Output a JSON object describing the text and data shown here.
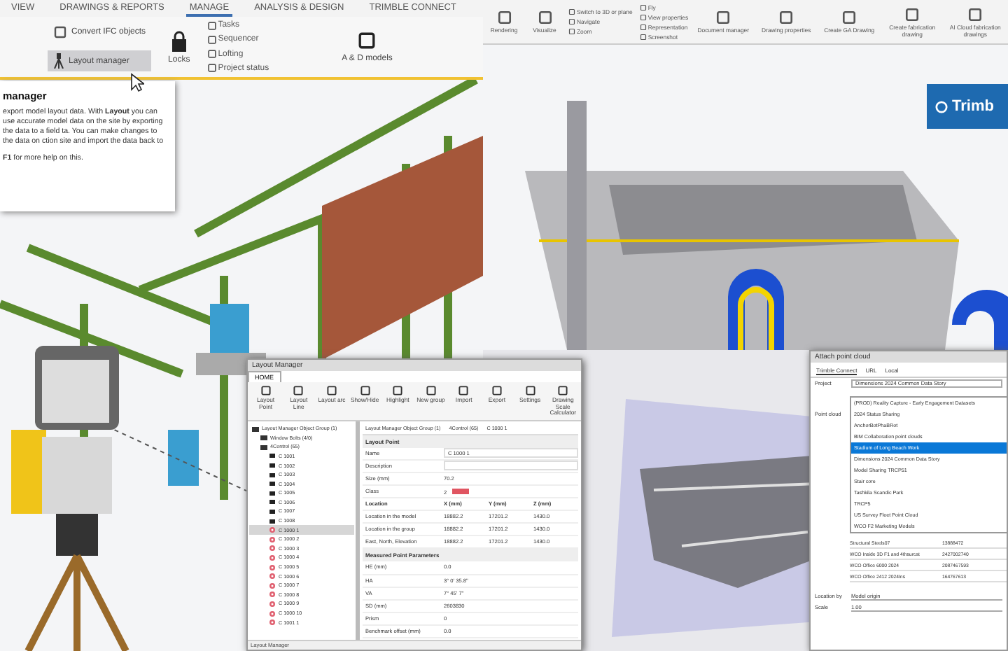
{
  "left_app": {
    "tabs": [
      {
        "label": "VIEW",
        "selected": false
      },
      {
        "label": "DRAWINGS & REPORTS",
        "selected": false
      },
      {
        "label": "MANAGE",
        "selected": true
      },
      {
        "label": "ANALYSIS & DESIGN",
        "selected": false
      },
      {
        "label": "TRIMBLE CONNECT",
        "selected": false
      }
    ],
    "convert_button": "Convert IFC objects",
    "layout_button": {
      "label": "Layout manager",
      "selected": true
    },
    "locks_button": "Locks",
    "small_items": [
      "Tasks",
      "Sequencer",
      "Lofting",
      "Project status"
    ],
    "models_button": "A & D models",
    "tooltip": {
      "title": "manager",
      "body": "export model layout data. With **Layout** you can use accurate model data on the site by exporting the data to a field ta. You can make changes to the data on ction site and import the data back to",
      "footer": "**F1** for more help on this."
    }
  },
  "right_app": {
    "large_tools": [
      "Rendering",
      "Visualize"
    ],
    "small_items": [
      "Switch to 3D or plane",
      "Navigate",
      "Zoom"
    ],
    "small_items_2": [
      "Fly",
      "View properties",
      "Representation",
      "Screenshot"
    ],
    "drawing_tools": [
      "Document manager",
      "Drawing properties",
      "Create GA Drawing",
      "Create fabrication drawing",
      "AI Cloud fabrication drawings"
    ],
    "logo": "Trimb"
  },
  "layout_manager": {
    "title": "Layout Manager",
    "tabs": [
      {
        "label": "HOME",
        "selected": true
      }
    ],
    "tools": [
      "Layout Point",
      "Layout Line",
      "Layout arc",
      "Show/Hide",
      "Highlight",
      "New group",
      "Import",
      "Export",
      "Settings",
      "Drawing Scale Calculator"
    ],
    "tree": [
      {
        "label": "Layout Manager Object Group (1)",
        "kind": "group",
        "selected": false,
        "children": [
          {
            "label": "Window Bolts (4/0)",
            "kind": "group",
            "selected": false
          },
          {
            "label": "4Control (65)",
            "kind": "group",
            "selected": false,
            "children": [
              {
                "label": "C 1001",
                "kind": "object",
                "selected": false
              },
              {
                "label": "C 1002",
                "kind": "object",
                "selected": false
              },
              {
                "label": "C 1003",
                "kind": "object",
                "selected": false
              },
              {
                "label": "C 1004",
                "kind": "object",
                "selected": false
              },
              {
                "label": "C 1005",
                "kind": "object",
                "selected": false
              },
              {
                "label": "C 1006",
                "kind": "object",
                "selected": false
              },
              {
                "label": "C 1007",
                "kind": "object",
                "selected": false
              },
              {
                "label": "C 1008",
                "kind": "object",
                "selected": false
              },
              {
                "label": "C 1000 1",
                "kind": "point",
                "selected": true
              },
              {
                "label": "C 1000 2",
                "kind": "point",
                "selected": false
              },
              {
                "label": "C 1000 3",
                "kind": "point",
                "selected": false
              },
              {
                "label": "C 1000 4",
                "kind": "point",
                "selected": false
              },
              {
                "label": "C 1000 5",
                "kind": "point",
                "selected": false
              },
              {
                "label": "C 1000 6",
                "kind": "point",
                "selected": false
              },
              {
                "label": "C 1000 7",
                "kind": "point",
                "selected": false
              },
              {
                "label": "C 1000 8",
                "kind": "point",
                "selected": false
              },
              {
                "label": "C 1000 9",
                "kind": "point",
                "selected": false
              },
              {
                "label": "C 1000 10",
                "kind": "point",
                "selected": false
              },
              {
                "label": "C 1001 1",
                "kind": "point",
                "selected": false
              }
            ]
          }
        ]
      }
    ],
    "breadcrumb": [
      "Layout Manager Object Group (1)",
      "4Control (65)",
      "C 1000 1"
    ],
    "point_section": "Layout Point",
    "point_rows": [
      {
        "label": "Name",
        "value": "C 1000 1",
        "kind": "field"
      },
      {
        "label": "Description",
        "kind": "field"
      },
      {
        "label": "Size (mm)",
        "value": "70.2",
        "kind": "text"
      },
      {
        "label": "Class",
        "value": "2",
        "kind": "swatch"
      }
    ],
    "location_header": [
      "Location",
      "X (mm)",
      "Y (mm)",
      "Z (mm)"
    ],
    "location_rows": [
      [
        "Location in the model",
        "18882.2",
        "17201.2",
        "1430.0"
      ],
      [
        "Location in the group",
        "18882.2",
        "17201.2",
        "1430.0"
      ],
      [
        "East, North, Elevation",
        "18882.2",
        "17201.2",
        "1430.0"
      ]
    ],
    "measured_section": "Measured Point Parameters",
    "measured_rows": [
      {
        "label": "HE (mm)",
        "value": "0.0"
      },
      {
        "label": "HA",
        "value": "3° 0' 35.8\""
      },
      {
        "label": "VA",
        "value": "7° 45' 7\""
      },
      {
        "label": "SD (mm)",
        "value": "2603830"
      },
      {
        "label": "Prism",
        "value": "0"
      },
      {
        "label": "Benchmark offset (mm)",
        "value": "0.0"
      }
    ],
    "status": "Layout Manager"
  },
  "point_cloud_dialog": {
    "title": "Attach point cloud",
    "tabs": [
      {
        "label": "Trimble Connect",
        "selected": true
      },
      {
        "label": "URL",
        "selected": false
      },
      {
        "label": "Local",
        "selected": false
      }
    ],
    "project_label": "Project",
    "project_value": "Dimensions 2024 Common Data Story",
    "options": [
      {
        "label": "(PROD) Reality Capture - Early Engagement Datasets",
        "selected": false
      },
      {
        "label": "2024 Status Sharing",
        "selected": false
      },
      {
        "label": "AnchorBotPhaBRot",
        "selected": false
      },
      {
        "label": "BIM Collaboration point clouds",
        "selected": false
      },
      {
        "label": "Stadium of Long Beach Work",
        "selected": true
      },
      {
        "label": "Dimensions 2024 Common Data Story",
        "selected": false
      },
      {
        "label": "Model Sharing TRCP51",
        "selected": false
      },
      {
        "label": "Stair core",
        "selected": false
      },
      {
        "label": "Tashkila Scandic Park",
        "selected": false
      },
      {
        "label": "TRCP5",
        "selected": false
      },
      {
        "label": "US Survey Fleet Point Cloud",
        "selected": false
      },
      {
        "label": "WCO F2 Marketing Models",
        "selected": false
      }
    ],
    "point_cloud_label": "Point cloud",
    "rows": [
      [
        "Structural Steels07",
        "13888472"
      ],
      [
        "WCO Inside 3D F1 and 4thsurcat",
        "2427002740"
      ],
      [
        "WCO Office 6000 2024",
        "2087467593"
      ],
      [
        "WCO Office 2412 2024Ins",
        "164767613"
      ]
    ],
    "location_label": "Location by",
    "location_value": "Model origin",
    "scale_label": "Scale",
    "scale_value": "1.00"
  }
}
